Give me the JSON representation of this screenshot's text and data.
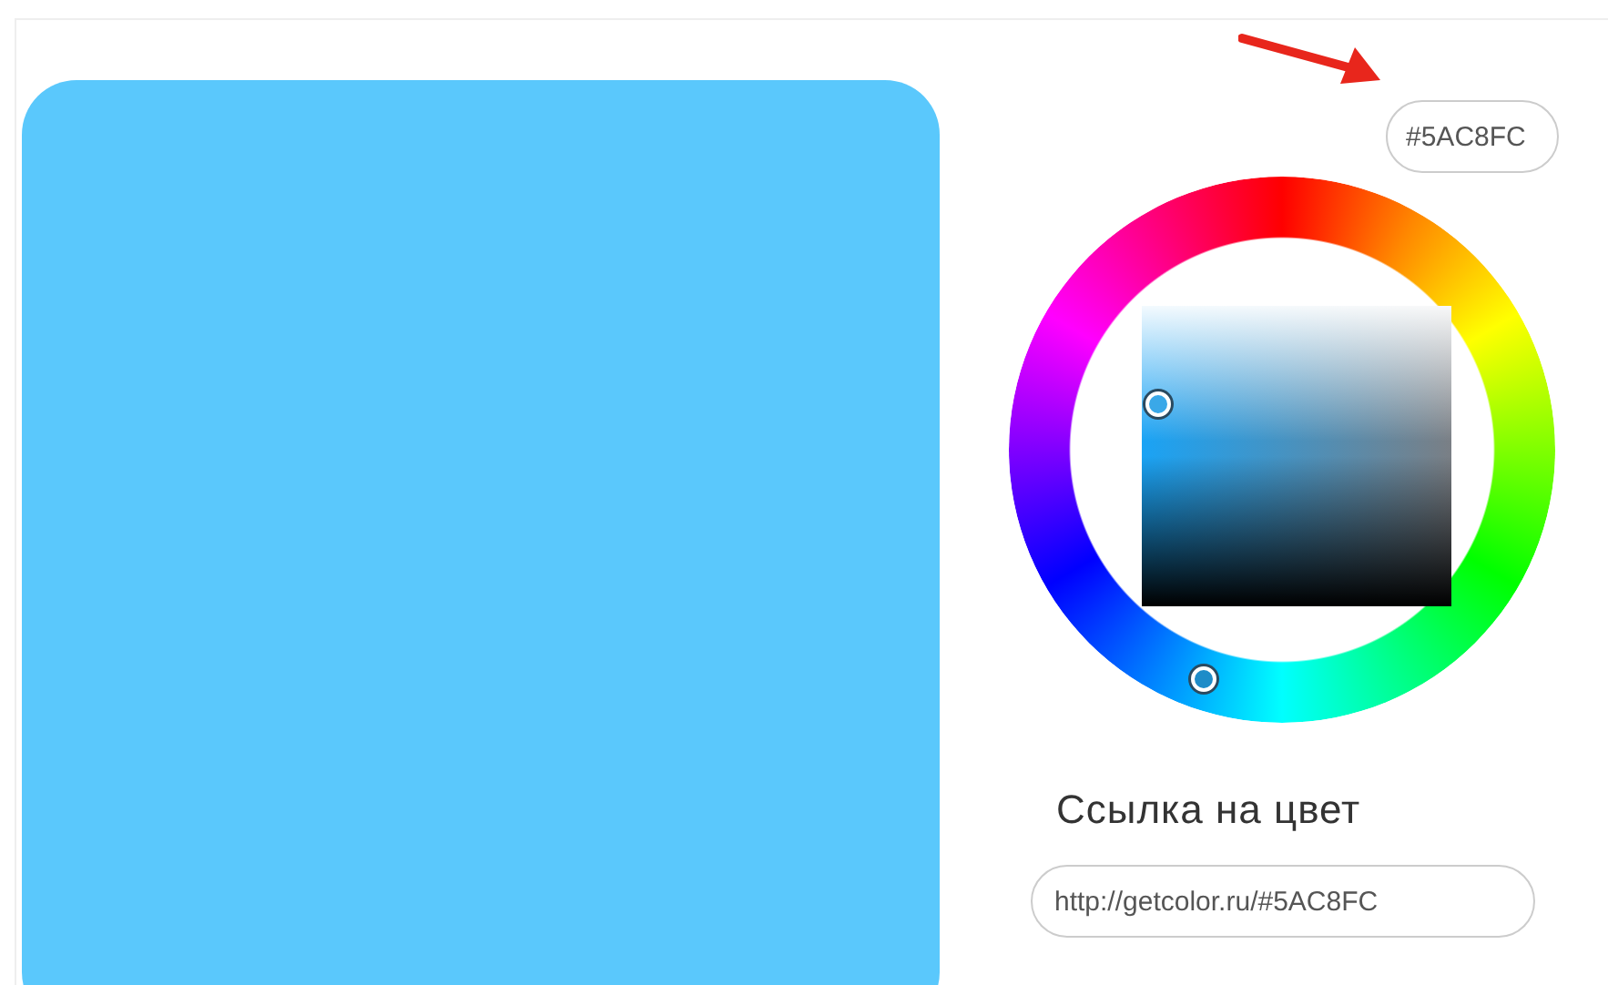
{
  "preview": {
    "color": "#5AC8FC"
  },
  "hex_field": {
    "value": "#5AC8FC"
  },
  "link_section": {
    "heading": "Ссылка на цвет",
    "value": "http://getcolor.ru/#5AC8FC"
  }
}
